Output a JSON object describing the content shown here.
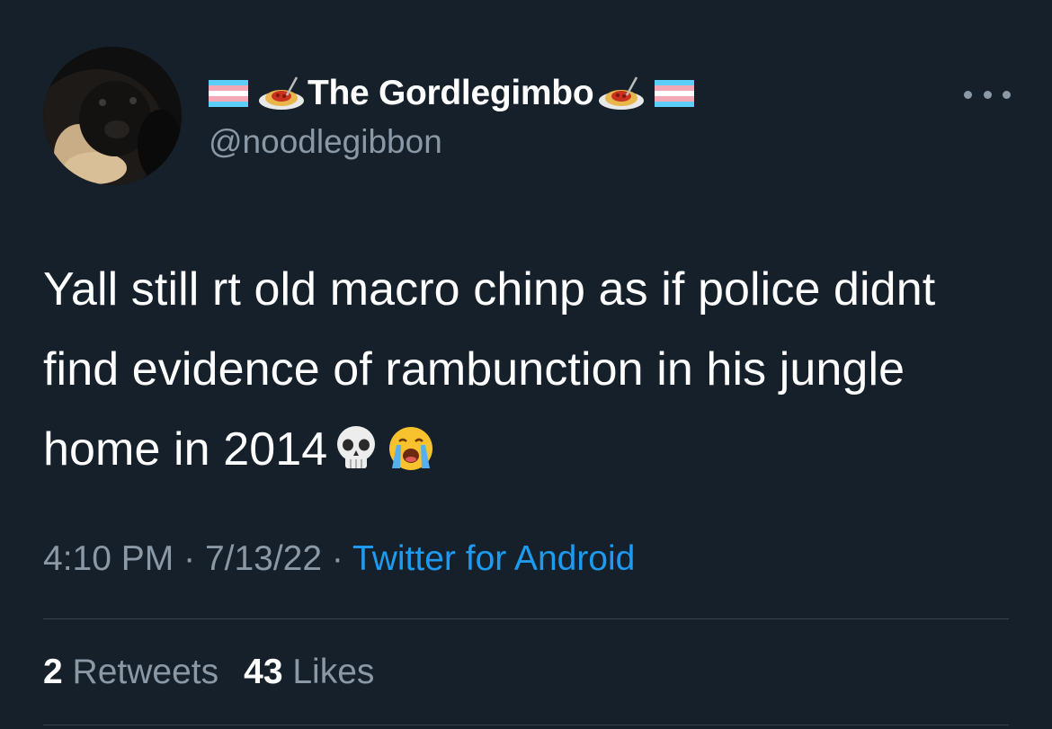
{
  "author": {
    "display_name": "The Gordlegimbo",
    "handle": "@noodlegibbon",
    "name_decorations": [
      "transgender-flag-icon",
      "spaghetti-icon",
      "spaghetti-icon",
      "transgender-flag-icon"
    ],
    "avatar": "gibbon-avatar"
  },
  "tweet": {
    "text": "Yall still rt old macro chinp as if police didnt find evidence of rambunction in his jungle home in 2014",
    "emojis": [
      "skull-icon",
      "loudly-crying-face-icon"
    ],
    "time": "4:10 PM",
    "separator": "·",
    "date": "7/13/22",
    "source": "Twitter for Android"
  },
  "stats": {
    "retweets_count": "2",
    "retweets_label": "Retweets",
    "likes_count": "43",
    "likes_label": "Likes"
  },
  "colors": {
    "background": "#15202b",
    "primary_text": "#ffffff",
    "secondary_text": "#8b98a5",
    "link": "#1d9bf0",
    "divider": "#38444d"
  }
}
